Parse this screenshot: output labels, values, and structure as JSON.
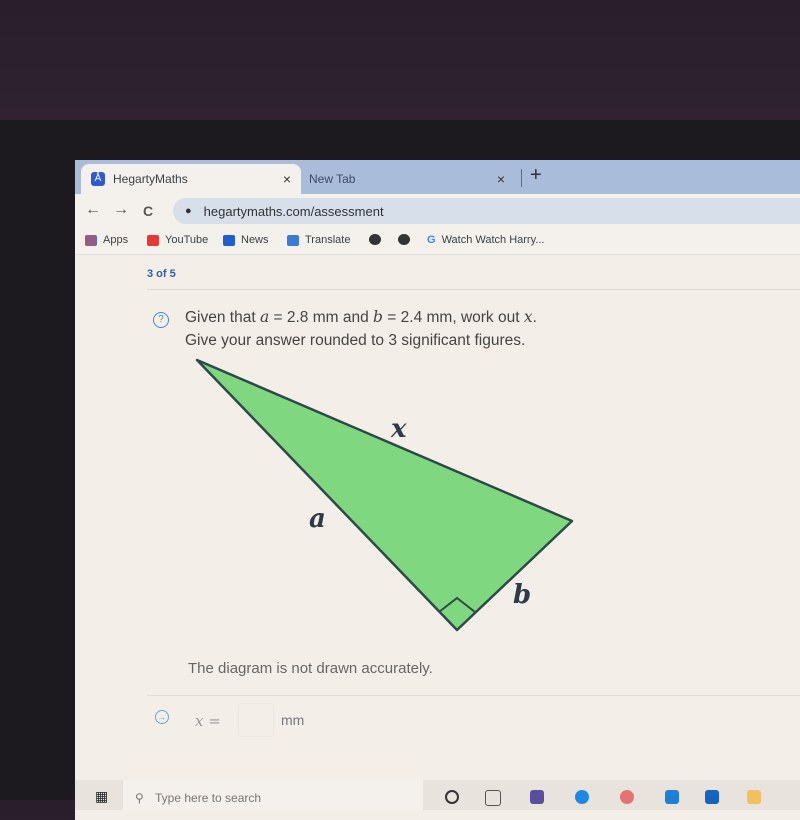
{
  "browser": {
    "tabs": [
      {
        "label": "HegartyMaths",
        "active": true,
        "favicon": "hegarty-logo-icon"
      },
      {
        "label": "New Tab",
        "active": false
      }
    ],
    "new_tab_symbol": "+",
    "close_symbol": "×",
    "url": "hegartymaths.com/assessment",
    "nav": {
      "back": "←",
      "forward": "→",
      "reload": "C"
    },
    "bookmarks": [
      {
        "label": "Apps",
        "icon": "apps-grid-icon"
      },
      {
        "label": "YouTube",
        "icon": "youtube-icon"
      },
      {
        "label": "News",
        "icon": "news-icon"
      },
      {
        "label": "Translate",
        "icon": "translate-icon"
      },
      {
        "label": "",
        "icon": "globe-icon"
      },
      {
        "label": "",
        "icon": "globe-icon"
      },
      {
        "label": "Watch Watch Harry...",
        "icon": "google-icon"
      }
    ]
  },
  "assessment": {
    "progress": "3 of 5",
    "question": {
      "line1_pre": "Given that ",
      "var_a": "a",
      "line1_mid1": " = 2.8 mm and ",
      "var_b": "b",
      "line1_mid2": " = 2.4 mm, work out ",
      "var_x": "x",
      "line1_end": ".",
      "line2": "Give your answer rounded to 3 significant figures."
    },
    "diagram": {
      "labels": {
        "hypotenuse": "x",
        "side_a": "a",
        "side_b": "b"
      },
      "fill": "#7fd87f",
      "stroke": "#2e4a48",
      "right_angle": true
    },
    "note": "The diagram is not drawn accurately.",
    "answer": {
      "label": "x =",
      "value": "",
      "unit": "mm"
    }
  },
  "taskbar": {
    "search_placeholder": "Type here to search"
  }
}
